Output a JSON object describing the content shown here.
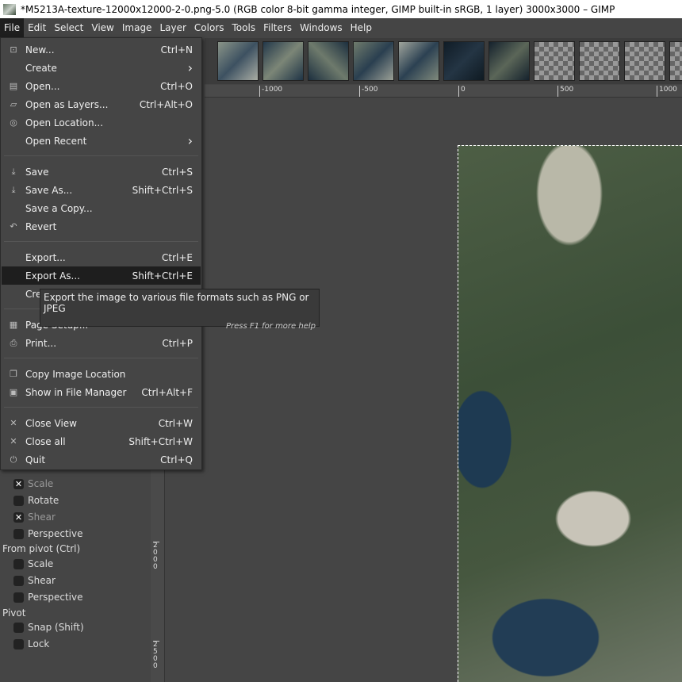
{
  "window": {
    "title": "*M5213A-texture-12000x12000-2-0.png-5.0 (RGB color 8-bit gamma integer, GIMP built-in sRGB, 1 layer) 3000x3000 – GIMP"
  },
  "menubar": [
    "File",
    "Edit",
    "Select",
    "View",
    "Image",
    "Layer",
    "Colors",
    "Tools",
    "Filters",
    "Windows",
    "Help"
  ],
  "file_menu": [
    {
      "icon": "new-icon",
      "label": "New...",
      "shortcut": "Ctrl+N",
      "top": 0
    },
    {
      "icon": "",
      "label": "Create",
      "shortcut": "›"
    },
    {
      "icon": "open-icon",
      "label": "Open...",
      "shortcut": "Ctrl+O"
    },
    {
      "icon": "open-layers-icon",
      "label": "Open as Layers...",
      "shortcut": "Ctrl+Alt+O"
    },
    {
      "icon": "globe-icon",
      "label": "Open Location...",
      "shortcut": ""
    },
    {
      "icon": "",
      "label": "Open Recent",
      "shortcut": "›"
    },
    {
      "sep": true
    },
    {
      "icon": "save-icon",
      "label": "Save",
      "shortcut": "Ctrl+S"
    },
    {
      "icon": "save-as-icon",
      "label": "Save As...",
      "shortcut": "Shift+Ctrl+S"
    },
    {
      "icon": "",
      "label": "Save a Copy...",
      "shortcut": ""
    },
    {
      "icon": "revert-icon",
      "label": "Revert",
      "shortcut": ""
    },
    {
      "sep": true
    },
    {
      "icon": "",
      "label": "Export...",
      "shortcut": "Ctrl+E"
    },
    {
      "icon": "",
      "label": "Export As...",
      "shortcut": "Shift+Ctrl+E",
      "highlighted": true
    },
    {
      "icon": "",
      "label": "Create Template...",
      "shortcut": ""
    },
    {
      "sep": true
    },
    {
      "icon": "page-setup-icon",
      "label": "Page Setup...",
      "shortcut": ""
    },
    {
      "icon": "print-icon",
      "label": "Print...",
      "shortcut": "Ctrl+P"
    },
    {
      "sep": true
    },
    {
      "icon": "copy-icon",
      "label": "Copy Image Location",
      "shortcut": ""
    },
    {
      "icon": "folder-icon",
      "label": "Show in File Manager",
      "shortcut": "Ctrl+Alt+F"
    },
    {
      "sep": true
    },
    {
      "icon": "close-icon",
      "label": "Close View",
      "shortcut": "Ctrl+W"
    },
    {
      "icon": "close-all-icon",
      "label": "Close all",
      "shortcut": "Shift+Ctrl+W"
    },
    {
      "icon": "quit-icon",
      "label": "Quit",
      "shortcut": "Ctrl+Q"
    }
  ],
  "tooltip": {
    "text": "Export the image to various file formats such as PNG or JPEG",
    "help": "Press F1 for more help"
  },
  "hruler": [
    "-1000",
    "-500",
    "0",
    "500",
    "1000"
  ],
  "vruler": [
    "2000",
    "2500"
  ],
  "tool_options": {
    "items1": [
      {
        "label": "Scale",
        "checked": true,
        "disabled": true
      },
      {
        "label": "Rotate",
        "checked": false
      },
      {
        "label": "Shear",
        "checked": true,
        "disabled": true
      },
      {
        "label": "Perspective",
        "checked": false
      }
    ],
    "section_pivot_from": "From pivot  (Ctrl)",
    "items2": [
      {
        "label": "Scale",
        "checked": false
      },
      {
        "label": "Shear",
        "checked": false
      },
      {
        "label": "Perspective",
        "checked": false
      }
    ],
    "section_pivot": "Pivot",
    "items3": [
      {
        "label": "Snap (Shift)",
        "checked": false
      },
      {
        "label": "Lock",
        "checked": false
      }
    ]
  }
}
